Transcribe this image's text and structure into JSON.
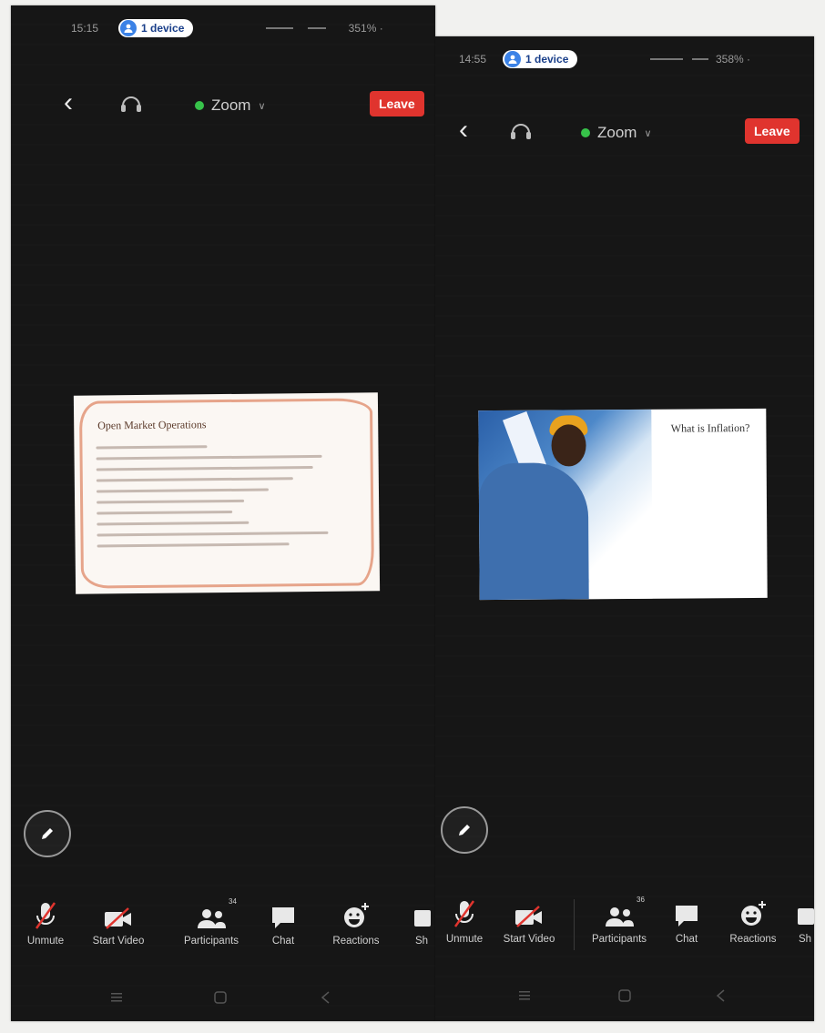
{
  "left_screen": {
    "status": {
      "time": "15:15",
      "device_pill": "1 device",
      "indicators": "     351% ·"
    },
    "topbar": {
      "meeting_title": "Zoom",
      "leave_label": "Leave"
    },
    "slide": {
      "title": "Open Market Operations"
    },
    "toolbar": {
      "unmute": "Unmute",
      "start_video": "Start Video",
      "participants": "Participants",
      "participants_count": "34",
      "chat": "Chat",
      "reactions": "Reactions",
      "share": "Sh"
    }
  },
  "right_screen": {
    "status": {
      "time": "14:55",
      "device_pill": "1 device",
      "indicators": "358% ·"
    },
    "topbar": {
      "meeting_title": "Zoom",
      "leave_label": "Leave"
    },
    "slide": {
      "title": "What is Inflation?"
    },
    "toolbar": {
      "unmute": "Unmute",
      "start_video": "Start Video",
      "participants": "Participants",
      "participants_count": "36",
      "chat": "Chat",
      "reactions": "Reactions",
      "share": "Sh"
    }
  },
  "colors": {
    "background": "#161616",
    "leave": "#e0342e",
    "connected_dot": "#37c24a",
    "device_pill_icon": "#3b82e6"
  },
  "icons": [
    "back-icon",
    "audio-icon",
    "pencil-icon",
    "muted-mic-icon",
    "video-off-icon",
    "participants-icon",
    "chat-icon",
    "reactions-icon",
    "share-icon",
    "nav-menu-icon",
    "nav-home-icon",
    "nav-back-icon"
  ]
}
